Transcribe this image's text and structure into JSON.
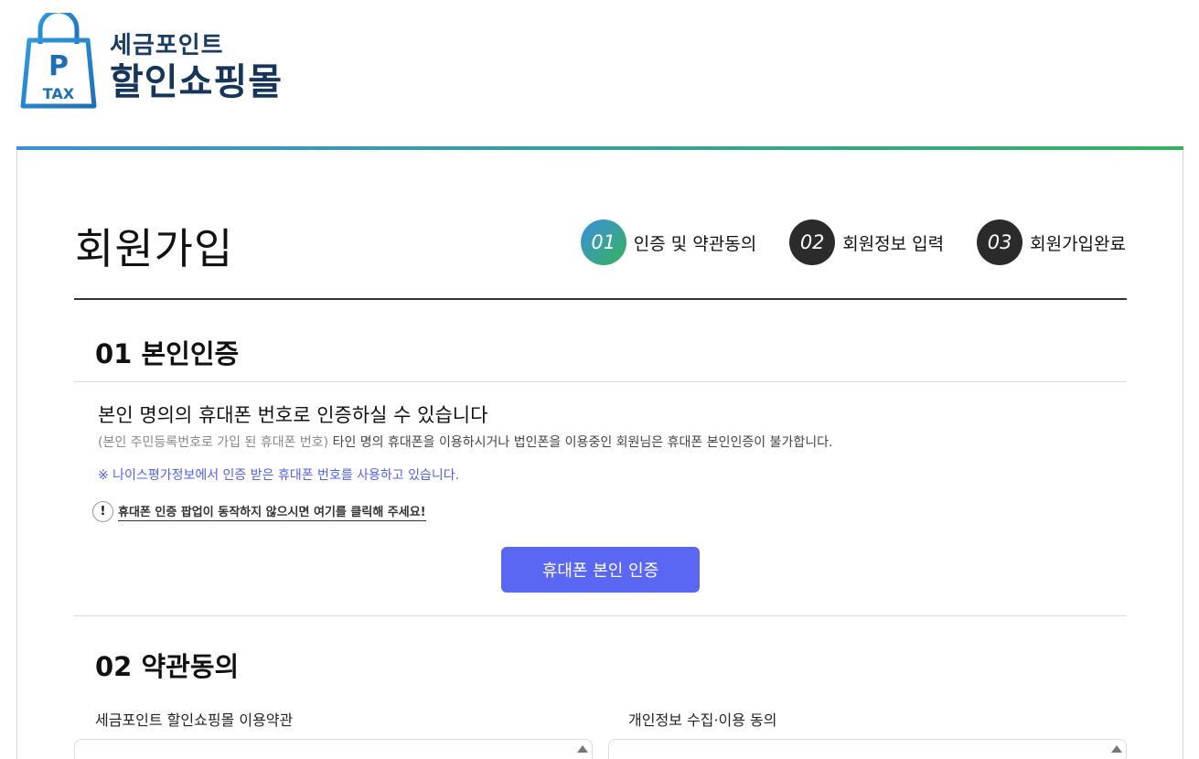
{
  "logo": {
    "line1": "세금포인트",
    "line2": "할인쇼핑몰",
    "badge_letter": "P",
    "badge_text": "TAX"
  },
  "page_title": "회원가입",
  "steps": [
    {
      "num": "01",
      "label": "인증 및 약관동의",
      "active": true
    },
    {
      "num": "02",
      "label": "회원정보 입력",
      "active": false
    },
    {
      "num": "03",
      "label": "회원가입완료",
      "active": false
    }
  ],
  "section1": {
    "title": "01 본인인증",
    "headline": "본인 명의의 휴대폰 번호로 인증하실 수 있습니다",
    "desc_gray": "(본인 주민등록번호로 가입 된 휴대폰 번호)",
    "desc_main": " 타인 명의 휴대폰을 이용하시거나 법인폰을 이용중인 회원님은 휴대폰 본인인증이 불가합니다.",
    "nice_note": "※ 나이스평가정보에서 인증 받은 휴대폰 번호를 사용하고 있습니다.",
    "popup_icon": "!",
    "popup_link": "휴대폰 인증 팝업이 동작하지 않으시면 여기를 클릭해 주세요!",
    "verify_button": "휴대폰 본인 인증"
  },
  "section2": {
    "title": "02 약관동의",
    "terms_left_label": "세금포인트 할인쇼핑몰 이용약관",
    "terms_right_label": "개인정보 수집·이용 동의"
  },
  "colors": {
    "brand_navy": "#15365a",
    "brand_blue": "#2e8fd4",
    "button": "#5a67f2",
    "note_blue": "#5260e8",
    "gradient_start": "#3b8fd8",
    "gradient_end": "#35b061"
  }
}
